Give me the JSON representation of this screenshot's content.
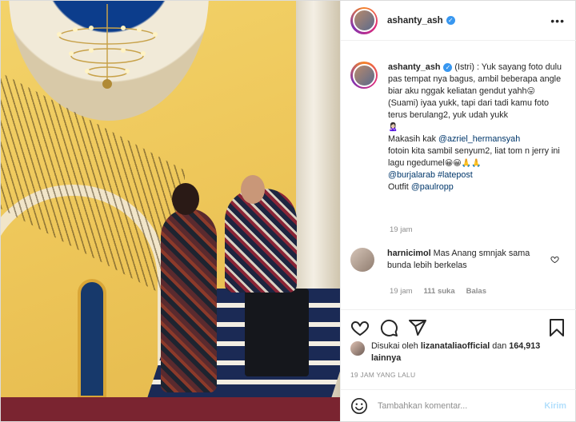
{
  "post": {
    "username": "ashanty_ash",
    "verified_icon": "verified-badge-icon",
    "more_icon": "more-options-icon",
    "caption": {
      "username": "ashanty_ash",
      "line1": " (Istri) : Yuk sayang foto dulu pas tempat nya bagus, ambil beberapa angle biar aku nggak keliatan gendut yahh",
      "emoji1": "😛",
      "line2": "(Suami) iyaa yukk, tapi dari tadi kamu foto terus berulang2, yuk udah yukk",
      "emoji2": "🙎🏻‍♀️",
      "line3_prefix": "Makasih kak ",
      "mention1": "@azriel_hermansyah",
      "line3_rest": "fotoin kita sambil senyum2, liat tom n jerry ini lagu ngedumel",
      "emoji3": "😀😀🙏🙏",
      "mention2": "@burjalarab",
      "hashtag": "#latepost",
      "outfit_prefix": "Outfit ",
      "mention3": "@paulropp"
    },
    "caption_time": "19 jam"
  },
  "comment": {
    "username": "harnicimol",
    "text": " Mas Anang smnjak sama bunda lebih berkelas",
    "time": "19 jam",
    "likes": "111 suka",
    "reply": "Balas"
  },
  "actions": {
    "like_icon": "heart-icon",
    "comment_icon": "comment-icon",
    "share_icon": "share-icon",
    "save_icon": "bookmark-icon"
  },
  "likes": {
    "prefix": "Disukai oleh ",
    "user": "lizanataliaofficial",
    "middle": " dan ",
    "count": "164,913 lainnya"
  },
  "timestamp": "19 JAM YANG LALU",
  "add_comment": {
    "placeholder": "Tambahkan komentar...",
    "post_label": "Kirim",
    "emoji_icon": "emoji-smile-icon"
  },
  "colors": {
    "link": "#00376b",
    "muted": "#8e8e8e",
    "verified": "#3897f0",
    "post_button_disabled": "#b2dffc"
  }
}
